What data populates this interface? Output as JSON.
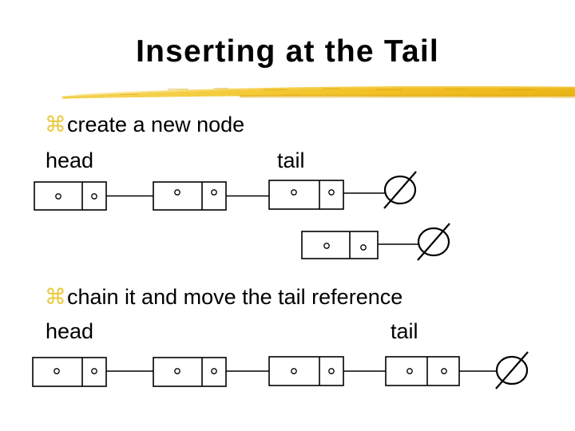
{
  "slide": {
    "title": "Inserting at the Tail",
    "background_color": "#ffffff",
    "text_color": "#000000",
    "accent_color": "#f2c230",
    "bullet_glyph_color": "#e9c93c"
  },
  "bullets": [
    {
      "glyph": "⌘",
      "text": "create a new node"
    },
    {
      "glyph": "⌘",
      "text": "chain it and move the tail reference"
    }
  ],
  "labels": {
    "head_1": "head",
    "tail_1": "tail",
    "head_2": "head",
    "tail_2": "tail"
  },
  "diagram_data": {
    "type": "linked-list",
    "node_cell_glyph": "o",
    "terminator_symbol": "null-slash",
    "groups": [
      {
        "name": "before-insert",
        "list_nodes": 3,
        "detached_nodes": 1,
        "terminators": 2,
        "head_points_to_node": 1,
        "tail_points_to_node": 3
      },
      {
        "name": "after-insert",
        "list_nodes": 4,
        "detached_nodes": 0,
        "terminators": 1,
        "head_points_to_node": 1,
        "tail_points_to_node": 4
      }
    ]
  }
}
